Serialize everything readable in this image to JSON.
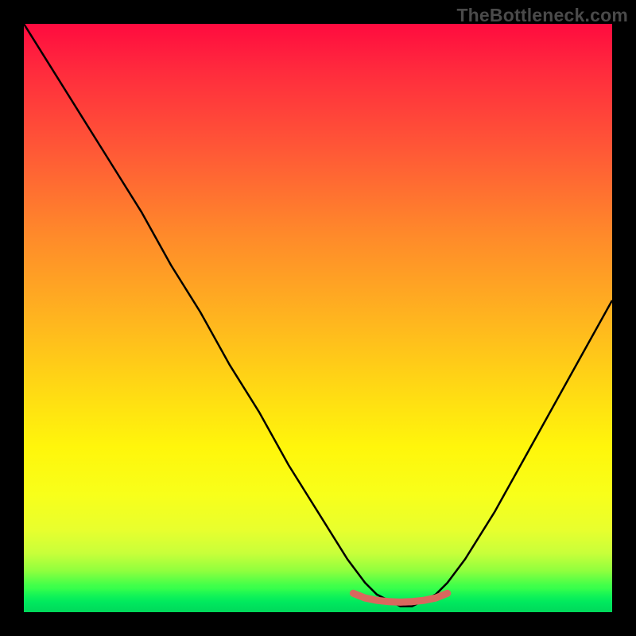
{
  "watermark": "TheBottleneck.com",
  "colors": {
    "frame": "#000000",
    "curve": "#000000",
    "accent": "#d9685e",
    "gradient_top": "#ff0b3f",
    "gradient_bottom": "#00d85a"
  },
  "chart_data": {
    "type": "line",
    "title": "",
    "xlabel": "",
    "ylabel": "",
    "xlim": [
      0,
      100
    ],
    "ylim": [
      0,
      100
    ],
    "series": [
      {
        "name": "bottleneck-curve",
        "x": [
          0,
          5,
          10,
          15,
          20,
          25,
          30,
          35,
          40,
          45,
          50,
          55,
          58,
          60,
          62,
          64,
          66,
          68,
          70,
          72,
          75,
          80,
          85,
          90,
          95,
          100
        ],
        "y": [
          100,
          92,
          84,
          76,
          68,
          59,
          51,
          42,
          34,
          25,
          17,
          9,
          5,
          3,
          2,
          1,
          1,
          2,
          3,
          5,
          9,
          17,
          26,
          35,
          44,
          53
        ]
      }
    ],
    "accent_segment": {
      "name": "minimum-band",
      "x": [
        56,
        58,
        60,
        62,
        64,
        66,
        68,
        70,
        72
      ],
      "y": [
        3.2,
        2.4,
        2.0,
        1.8,
        1.7,
        1.8,
        2.0,
        2.4,
        3.2
      ]
    },
    "notes": "V-shaped curve over a vertical heat gradient. Minimum is near x≈65 on a 0–100 normalized axis. No axis ticks, labels, legend, or gridlines are visible; watermark text is the only text."
  }
}
